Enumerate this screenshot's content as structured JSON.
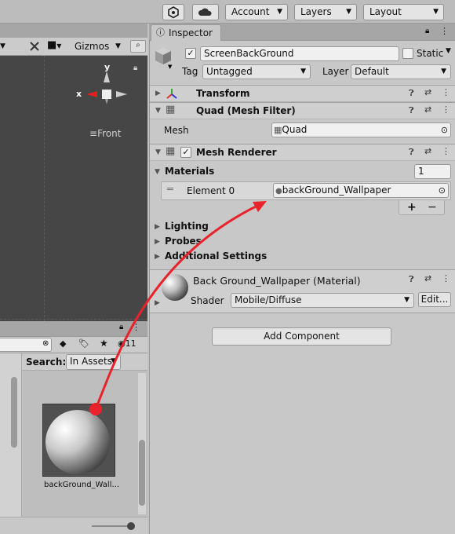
{
  "toolbar": {
    "account": "Account",
    "layers": "Layers",
    "layout": "Layout"
  },
  "scene": {
    "gizmos": "Gizmos",
    "axis_y": "y",
    "axis_x": "x",
    "view_label": "Front"
  },
  "inspector": {
    "tab": "Inspector",
    "object_name": "ScreenBackGround",
    "static_label": "Static",
    "tag_label": "Tag",
    "tag_value": "Untagged",
    "layer_label": "Layer",
    "layer_value": "Default",
    "transform": "Transform",
    "mesh_filter": "Quad (Mesh Filter)",
    "mesh_label": "Mesh",
    "mesh_value": "Quad",
    "mesh_renderer": "Mesh Renderer",
    "materials_label": "Materials",
    "materials_count": "1",
    "element_label": "Element 0",
    "element_value": "backGround_Wallpaper",
    "plus": "+",
    "minus": "−",
    "lighting": "Lighting",
    "probes": "Probes",
    "additional": "Additional Settings",
    "material_title": "Back Ground_Wallpaper (Material)",
    "shader_label": "Shader",
    "shader_value": "Mobile/Diffuse",
    "edit_button": "Edit...",
    "add_component": "Add Component"
  },
  "project": {
    "search_label": "Search:",
    "search_scope": "In Assets",
    "count": "11",
    "asset_name": "backGround_Wall..."
  },
  "colors": {
    "arrow": "#e8232b",
    "scene_bg": "#464646"
  }
}
